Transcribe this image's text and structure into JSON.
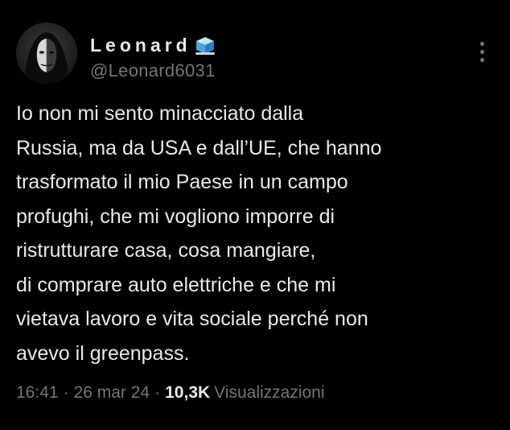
{
  "author": {
    "display_name": "Leonard",
    "badge_icon": "ice-cube-icon",
    "handle": "@Leonard6031"
  },
  "menu": {
    "icon": "more-options-icon"
  },
  "tweet": {
    "text": "Io non mi sento minacciato dalla\nRussia, ma da USA e dall’UE, che hanno\ntrasformato il mio Paese in un campo\nprofughi, che mi vogliono imporre di\nristrutturare casa, cosa mangiare,\ndi comprare auto elettriche e che mi\nvietava lavoro e vita sociale perché non\navevo il greenpass."
  },
  "meta": {
    "time": "16:41",
    "separator": "·",
    "date": "26 mar 24",
    "views_count": "10,3K",
    "views_label": "Visualizzazioni"
  },
  "colors": {
    "background": "#000000",
    "text_primary": "#e7e9ea",
    "text_secondary": "#71767b",
    "badge_blue": "#4aa3df"
  }
}
